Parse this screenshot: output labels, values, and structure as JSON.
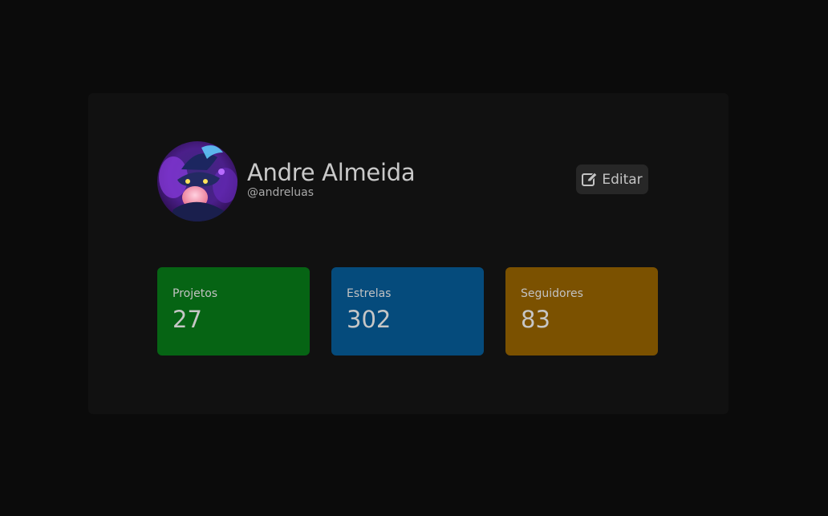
{
  "profile": {
    "name": "Andre Almeida",
    "handle": "@andreluas",
    "avatar_icon": "avatar-image"
  },
  "actions": {
    "edit_label": "Editar",
    "edit_icon": "edit-icon"
  },
  "stats": [
    {
      "label": "Projetos",
      "value": "27",
      "color": "#066414"
    },
    {
      "label": "Estrelas",
      "value": "302",
      "color": "#054b7c"
    },
    {
      "label": "Seguidores",
      "value": "83",
      "color": "#7b5100"
    }
  ]
}
